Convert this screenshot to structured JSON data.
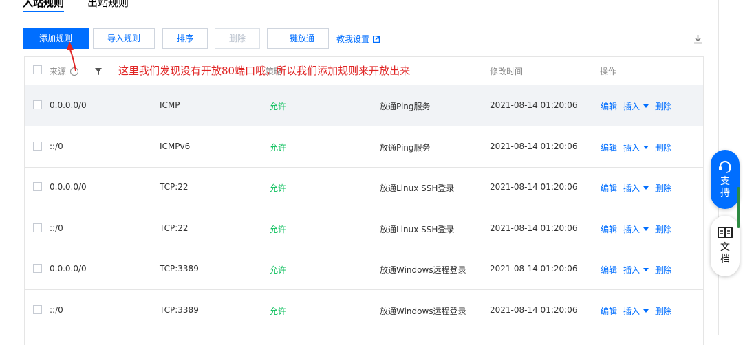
{
  "tabs": [
    {
      "label": "入站规则",
      "active": true
    },
    {
      "label": "出站规则",
      "active": false
    }
  ],
  "toolbar": {
    "add_rule": "添加规则",
    "import_rules": "导入规则",
    "sort": "排序",
    "delete": "删除",
    "one_click_open": "一键放通",
    "help_link": "教我设置"
  },
  "table": {
    "headers": {
      "source": "来源",
      "policy": "策略",
      "modified": "修改时间",
      "actions": "操作"
    },
    "ops": {
      "edit": "编辑",
      "insert": "插入",
      "delete": "删除"
    },
    "rows": [
      {
        "source": "0.0.0.0/0",
        "protocol": "ICMP",
        "policy": "允许",
        "remark": "放通Ping服务",
        "time": "2021-08-14 01:20:06"
      },
      {
        "source": "::/0",
        "protocol": "ICMPv6",
        "policy": "允许",
        "remark": "放通Ping服务",
        "time": "2021-08-14 01:20:06"
      },
      {
        "source": "0.0.0.0/0",
        "protocol": "TCP:22",
        "policy": "允许",
        "remark": "放通Linux SSH登录",
        "time": "2021-08-14 01:20:06"
      },
      {
        "source": "::/0",
        "protocol": "TCP:22",
        "policy": "允许",
        "remark": "放通Linux SSH登录",
        "time": "2021-08-14 01:20:06"
      },
      {
        "source": "0.0.0.0/0",
        "protocol": "TCP:3389",
        "policy": "允许",
        "remark": "放通Windows远程登录",
        "time": "2021-08-14 01:20:06"
      },
      {
        "source": "::/0",
        "protocol": "TCP:3389",
        "policy": "允许",
        "remark": "放通Windows远程登录",
        "time": "2021-08-14 01:20:06"
      }
    ]
  },
  "annotation": "这里我们发现没有开放80端口哦，所以我们添加规则来开放出来",
  "widgets": {
    "support_label_1": "支",
    "support_label_2": "持",
    "docs_label_1": "文",
    "docs_label_2": "档"
  },
  "colors": {
    "primary": "#006eff",
    "allow_green": "#0abf5b",
    "annotation_red": "#e02424"
  }
}
